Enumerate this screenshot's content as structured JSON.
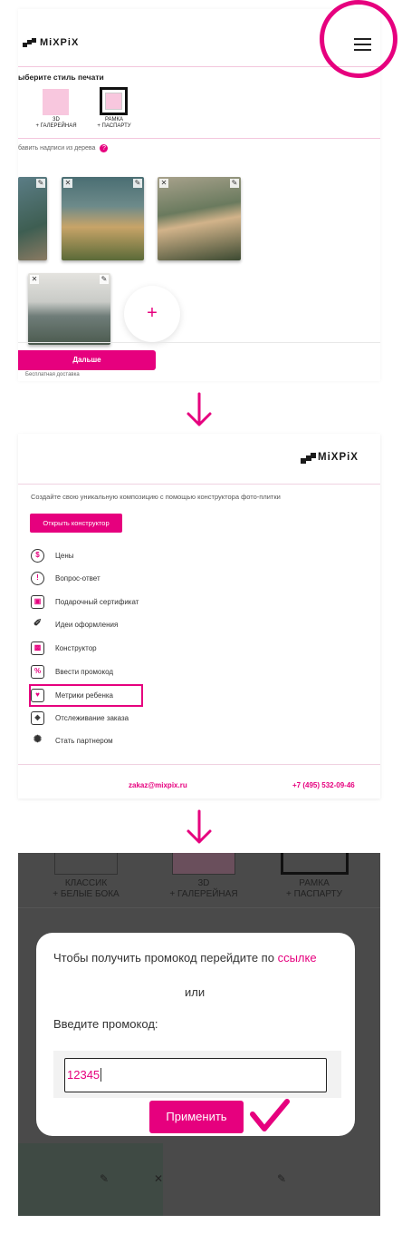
{
  "brand": {
    "name": "MiXPiX",
    "accent": "#e6007e"
  },
  "step1": {
    "section_title": "ыберите стиль печати",
    "styles": [
      {
        "line1": "3D",
        "line2": "+ ГАЛЕРЕЙНАЯ"
      },
      {
        "line1": "РАМКА",
        "line2": "+ ПАСПАРТУ"
      }
    ],
    "tree_label": "бавить надписи из дерева",
    "help_icon": "?",
    "plus": "+",
    "next_label": "Дальше",
    "delivery": "Бесплатная доставка"
  },
  "step2": {
    "promo_text": "Создайте свою уникальную композицию с помощью конструктора фото-плитки",
    "open_constructor": "Открыть конструктор",
    "menu": [
      {
        "label": "Цены",
        "icon": "price-icon"
      },
      {
        "label": "Вопрос-ответ",
        "icon": "faq-icon"
      },
      {
        "label": "Подарочный сертификат",
        "icon": "gift-certificate-icon"
      },
      {
        "label": "Идеи оформления",
        "icon": "magic-wand-icon"
      },
      {
        "label": "Конструктор",
        "icon": "constructor-icon"
      },
      {
        "label": "Ввести промокод",
        "icon": "promo-ticket-icon"
      },
      {
        "label": "Метрики ребенка",
        "icon": "baby-metrics-icon"
      },
      {
        "label": "Отслеживание заказа",
        "icon": "package-icon"
      },
      {
        "label": "Стать партнером",
        "icon": "handshake-icon"
      }
    ],
    "email": "zakaz@mixpix.ru",
    "phone": "+7 (495) 532-09-46"
  },
  "step3": {
    "bg_labels": [
      {
        "line1": "КЛАССИК",
        "line2": "+ БЕЛЫЕ БОКА"
      },
      {
        "line1": "3D",
        "line2": "+ ГАЛЕРЕЙНАЯ"
      },
      {
        "line1": "РАМКА",
        "line2": "+ ПАСПАРТУ"
      }
    ],
    "modal": {
      "text_before_link": "Чтобы получить промокод перейдите по",
      "link_text": "ссылке",
      "or": "или",
      "prompt": "Введите промокод:",
      "input_value": "12345",
      "apply_label": "Применить"
    }
  }
}
